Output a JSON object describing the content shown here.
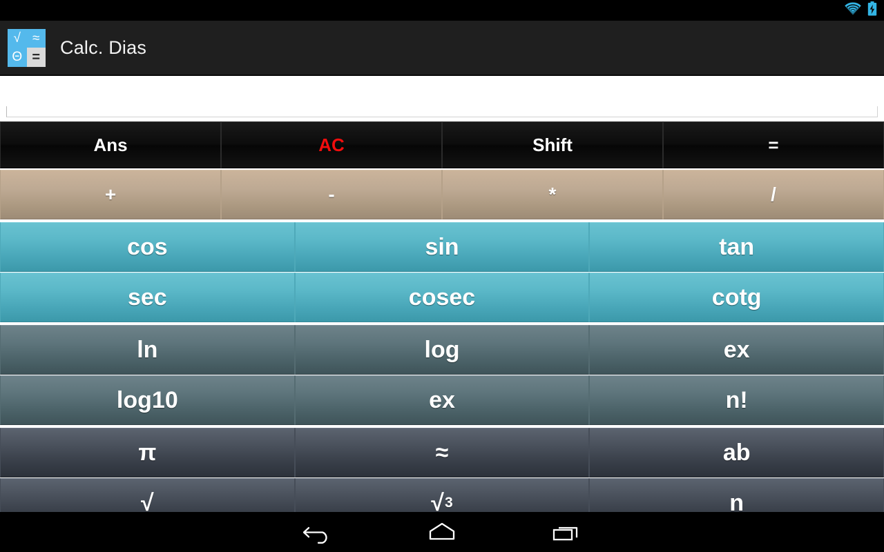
{
  "statusbar": {
    "icons": [
      {
        "name": "wifi-icon",
        "label": "wifi"
      },
      {
        "name": "battery-charging-icon",
        "label": "battery charging"
      }
    ],
    "accent_color": "#33b5e5"
  },
  "actionbar": {
    "title": "Calc. Dias",
    "icon": {
      "name": "app-icon",
      "background": "#54b9ec",
      "glyph_sqrt": "√",
      "glyph_approx": "≈",
      "glyph_theta": "Θ",
      "glyph_equals": "=",
      "equals_background": "#dadada"
    },
    "background": "#1f1f1f"
  },
  "display": {
    "value": "",
    "placeholder": "",
    "background": "#ffffff"
  },
  "keypad": {
    "groups": [
      {
        "name": "command-row",
        "style": "dark",
        "columns": 4,
        "rows": [
          [
            {
              "label": "Ans",
              "name": "key-ans",
              "color": "#ffffff"
            },
            {
              "label": "AC",
              "name": "key-ac",
              "color": "#f20d0d"
            },
            {
              "label": "Shift",
              "name": "key-shift",
              "color": "#ffffff"
            },
            {
              "label": "=",
              "name": "key-equals",
              "color": "#ffffff"
            }
          ]
        ]
      },
      {
        "name": "operator-row",
        "style": "tan",
        "columns": 4,
        "rows": [
          [
            {
              "label": "+",
              "name": "key-plus"
            },
            {
              "label": "-",
              "name": "key-minus"
            },
            {
              "label": "*",
              "name": "key-multiply"
            },
            {
              "label": "/",
              "name": "key-divide"
            }
          ]
        ]
      },
      {
        "name": "trig-rows",
        "style": "teal",
        "columns": 3,
        "rows": [
          [
            {
              "label": "cos",
              "name": "key-cos"
            },
            {
              "label": "sin",
              "name": "key-sin"
            },
            {
              "label": "tan",
              "name": "key-tan"
            }
          ],
          [
            {
              "label": "sec",
              "name": "key-sec"
            },
            {
              "label": "cosec",
              "name": "key-cosec"
            },
            {
              "label": "cotg",
              "name": "key-cotg"
            }
          ]
        ]
      },
      {
        "name": "log-rows",
        "style": "slate",
        "columns": 3,
        "rows": [
          [
            {
              "label": "ln",
              "name": "key-ln"
            },
            {
              "label": "log",
              "name": "key-log"
            },
            {
              "label": "ex",
              "name": "key-ex"
            }
          ],
          [
            {
              "label": "log10",
              "name": "key-log10"
            },
            {
              "label": "ex",
              "name": "key-ex-2"
            },
            {
              "label": "n!",
              "name": "key-factorial"
            }
          ]
        ]
      },
      {
        "name": "constant-rows",
        "style": "graphite",
        "columns": 3,
        "rows": [
          [
            {
              "label": "π",
              "name": "key-pi"
            },
            {
              "label": "≈",
              "name": "key-approx"
            },
            {
              "label": "ab",
              "name": "key-ab"
            }
          ],
          [
            {
              "label": "√",
              "name": "key-sqrt"
            },
            {
              "label": "√",
              "sup": "3",
              "name": "key-cbrt"
            },
            {
              "label": "n",
              "name": "key-n"
            }
          ]
        ]
      }
    ]
  },
  "navbar": {
    "buttons": [
      {
        "name": "nav-back-icon",
        "label": "Back"
      },
      {
        "name": "nav-home-icon",
        "label": "Home"
      },
      {
        "name": "nav-recents-icon",
        "label": "Recents"
      }
    ]
  }
}
